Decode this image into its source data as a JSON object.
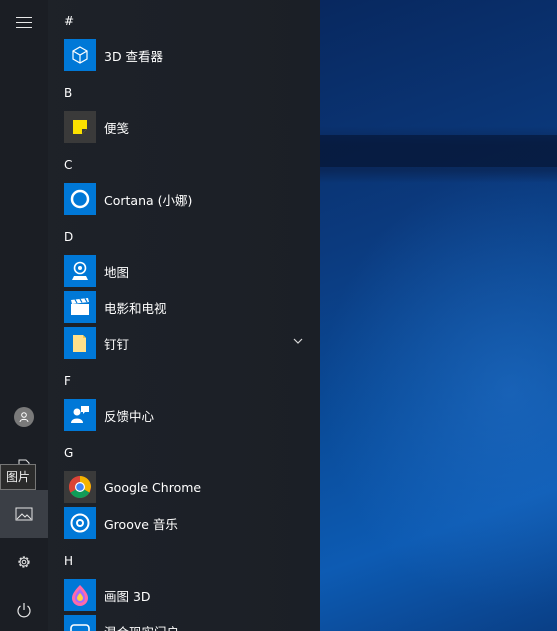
{
  "tooltip": "图片",
  "rail": {
    "menu_icon": "hamburger-icon",
    "user_icon": "user-icon",
    "pictures_icon": "pictures-icon",
    "settings_icon": "gear-icon",
    "power_icon": "power-icon"
  },
  "sections": [
    {
      "letter": "#",
      "items": [
        {
          "label": "3D 查看器",
          "icon": "3d-viewer-icon",
          "tile_color": "#0078d7"
        }
      ]
    },
    {
      "letter": "B",
      "items": [
        {
          "label": "便笺",
          "icon": "sticky-notes-icon",
          "tile_color": "#3a3a3a"
        }
      ]
    },
    {
      "letter": "C",
      "items": [
        {
          "label": "Cortana (小娜)",
          "icon": "cortana-icon",
          "tile_color": "#0078d7"
        }
      ]
    },
    {
      "letter": "D",
      "items": [
        {
          "label": "地图",
          "icon": "maps-icon",
          "tile_color": "#0078d7"
        },
        {
          "label": "电影和电视",
          "icon": "movies-tv-icon",
          "tile_color": "#0078d7"
        },
        {
          "label": "钉钉",
          "icon": "folder-icon",
          "tile_color": "#0078d7",
          "expandable": true
        }
      ]
    },
    {
      "letter": "F",
      "items": [
        {
          "label": "反馈中心",
          "icon": "feedback-hub-icon",
          "tile_color": "#0078d7"
        }
      ]
    },
    {
      "letter": "G",
      "items": [
        {
          "label": "Google Chrome",
          "icon": "chrome-icon",
          "tile_color": "#3a3a3a"
        },
        {
          "label": "Groove 音乐",
          "icon": "groove-music-icon",
          "tile_color": "#0078d7"
        }
      ]
    },
    {
      "letter": "H",
      "items": [
        {
          "label": "画图 3D",
          "icon": "paint-3d-icon",
          "tile_color": "#0078d7"
        },
        {
          "label": "混合现实门户",
          "icon": "mixed-reality-icon",
          "tile_color": "#0078d7"
        }
      ]
    }
  ]
}
